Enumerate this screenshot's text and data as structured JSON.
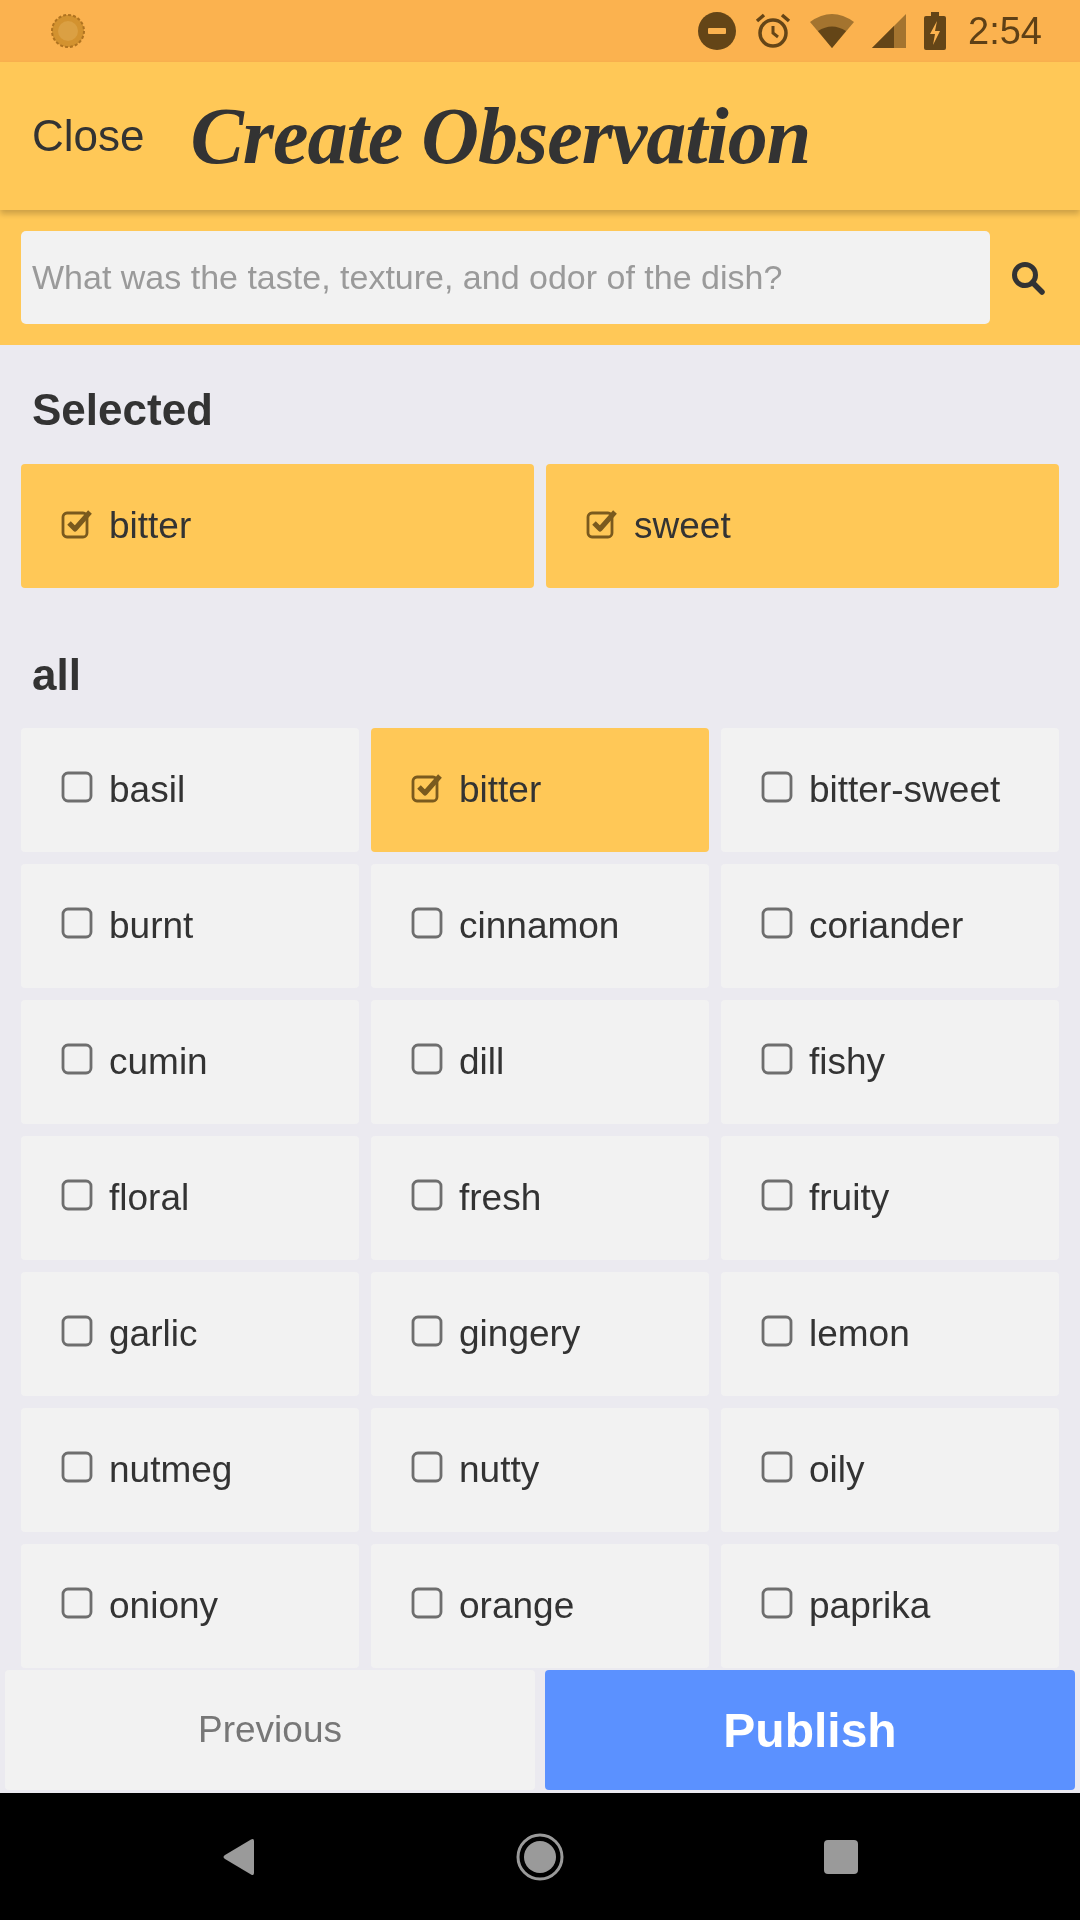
{
  "status_bar": {
    "time": "2:54"
  },
  "header": {
    "close_label": "Close",
    "title": "Create Observation"
  },
  "search": {
    "placeholder": "What was the taste, texture, and odor of the dish?"
  },
  "selected_section": {
    "heading": "Selected",
    "items": [
      {
        "label": "bitter",
        "checked": true
      },
      {
        "label": "sweet",
        "checked": true
      }
    ]
  },
  "all_section": {
    "heading": "all",
    "items": [
      {
        "label": "basil",
        "checked": false
      },
      {
        "label": "bitter",
        "checked": true
      },
      {
        "label": "bitter-sweet",
        "checked": false
      },
      {
        "label": "burnt",
        "checked": false
      },
      {
        "label": "cinnamon",
        "checked": false
      },
      {
        "label": "coriander",
        "checked": false
      },
      {
        "label": "cumin",
        "checked": false
      },
      {
        "label": "dill",
        "checked": false
      },
      {
        "label": "fishy",
        "checked": false
      },
      {
        "label": "floral",
        "checked": false
      },
      {
        "label": "fresh",
        "checked": false
      },
      {
        "label": "fruity",
        "checked": false
      },
      {
        "label": "garlic",
        "checked": false
      },
      {
        "label": "gingery",
        "checked": false
      },
      {
        "label": "lemon",
        "checked": false
      },
      {
        "label": "nutmeg",
        "checked": false
      },
      {
        "label": "nutty",
        "checked": false
      },
      {
        "label": "oily",
        "checked": false
      },
      {
        "label": "oniony",
        "checked": false
      },
      {
        "label": "orange",
        "checked": false
      },
      {
        "label": "paprika",
        "checked": false
      }
    ]
  },
  "footer": {
    "previous_label": "Previous",
    "publish_label": "Publish"
  }
}
